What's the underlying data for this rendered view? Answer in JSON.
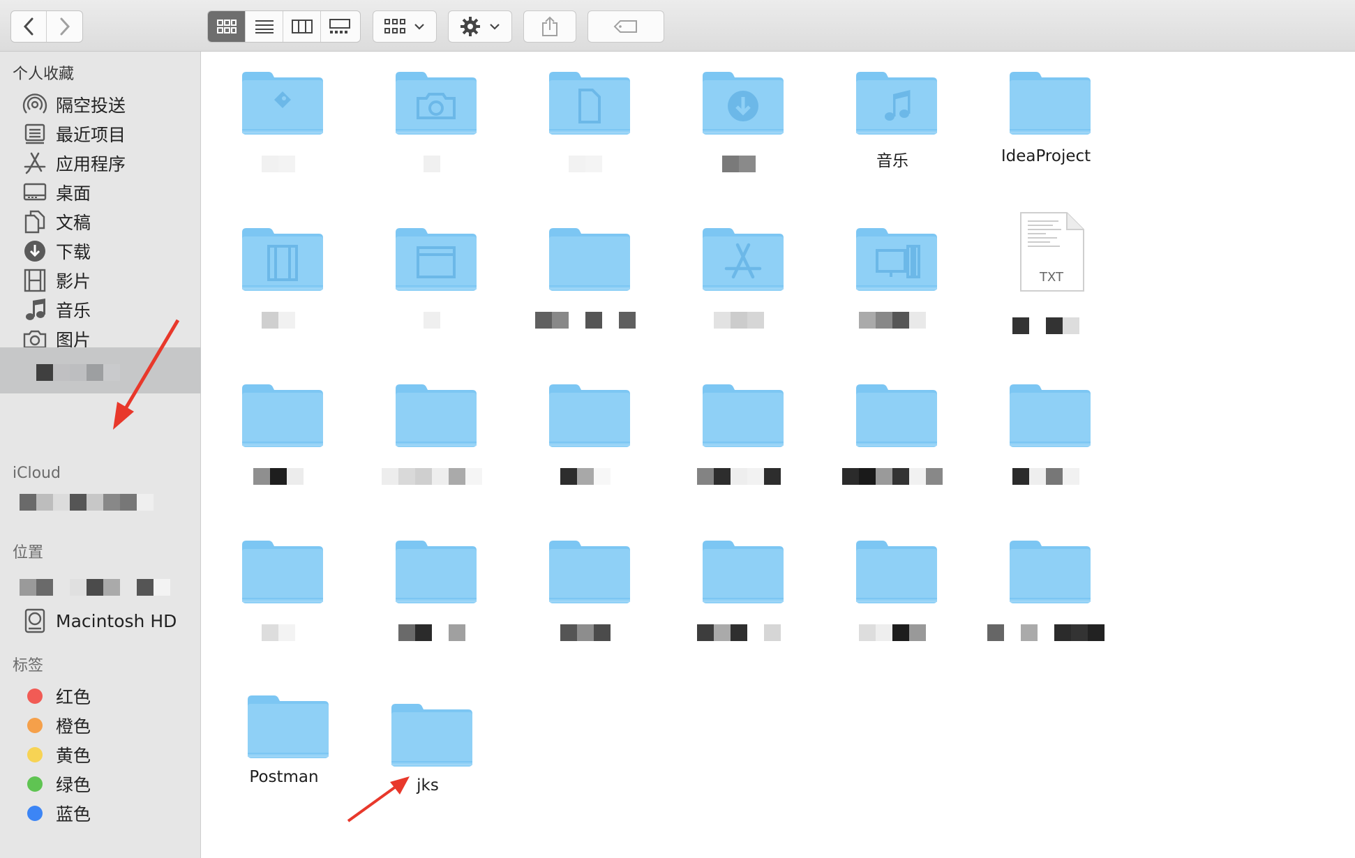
{
  "toolbar": {
    "back_icon": "chevron-left-icon",
    "forward_icon": "chevron-right-icon",
    "view_modes": [
      "icon-view-icon",
      "list-view-icon",
      "column-view-icon",
      "gallery-view-icon"
    ],
    "group_icon": "group-by-icon",
    "action_icon": "gear-icon",
    "share_icon": "share-icon",
    "tag_icon": "tag-icon"
  },
  "sidebar": {
    "favorites_header": "个人收藏",
    "favorites": [
      {
        "label": "隔空投送",
        "icon": "airdrop-icon"
      },
      {
        "label": "最近项目",
        "icon": "recents-icon"
      },
      {
        "label": "应用程序",
        "icon": "applications-icon"
      },
      {
        "label": "桌面",
        "icon": "desktop-icon"
      },
      {
        "label": "文稿",
        "icon": "documents-icon"
      },
      {
        "label": "下载",
        "icon": "download-icon"
      },
      {
        "label": "影片",
        "icon": "movies-icon"
      },
      {
        "label": "音乐",
        "icon": "music-icon"
      },
      {
        "label": "图片",
        "icon": "pictures-icon"
      }
    ],
    "icloud_header": "iCloud",
    "locations_header": "位置",
    "locations": [
      {
        "label": "Macintosh HD",
        "icon": "hard-disk-icon"
      }
    ],
    "tags_header": "标签",
    "tags": [
      {
        "label": "红色",
        "color": "#f15b55"
      },
      {
        "label": "橙色",
        "color": "#f5a04a"
      },
      {
        "label": "黄色",
        "color": "#f7d354"
      },
      {
        "label": "绿色",
        "color": "#5fc452"
      },
      {
        "label": "蓝色",
        "color": "#3c85f5"
      }
    ]
  },
  "content": {
    "folder_color": "#8fd0f6",
    "items": [
      {
        "name": "",
        "icon": "developer-folder-icon"
      },
      {
        "name": "",
        "icon": "camera-folder-icon"
      },
      {
        "name": "",
        "icon": "document-folder-icon"
      },
      {
        "name": "",
        "icon": "downloads-folder-icon"
      },
      {
        "name": "音乐",
        "icon": "music-folder-icon"
      },
      {
        "name": "IdeaProject",
        "icon": "folder-icon"
      },
      {
        "name": "",
        "icon": "movies-folder-icon"
      },
      {
        "name": "",
        "icon": "window-folder-icon"
      },
      {
        "name": "",
        "icon": "folder-icon"
      },
      {
        "name": "",
        "icon": "applications-folder-icon"
      },
      {
        "name": "",
        "icon": "desktop-folder-icon"
      },
      {
        "name": "",
        "icon": "txt-file-icon",
        "file_type": "TXT"
      },
      {
        "name": "",
        "icon": "folder-icon"
      },
      {
        "name": "",
        "icon": "folder-icon"
      },
      {
        "name": "",
        "icon": "folder-icon"
      },
      {
        "name": "",
        "icon": "folder-icon"
      },
      {
        "name": "",
        "icon": "folder-icon"
      },
      {
        "name": "",
        "icon": "folder-icon"
      },
      {
        "name": "",
        "icon": "folder-icon"
      },
      {
        "name": "",
        "icon": "folder-icon"
      },
      {
        "name": "",
        "icon": "folder-icon"
      },
      {
        "name": "",
        "icon": "folder-icon"
      },
      {
        "name": "",
        "icon": "folder-icon"
      },
      {
        "name": "",
        "icon": "folder-icon"
      },
      {
        "name": "Postman",
        "icon": "folder-icon"
      },
      {
        "name": "jks",
        "icon": "folder-icon"
      }
    ]
  },
  "annotations": {
    "arrow_color": "#e8382b"
  }
}
